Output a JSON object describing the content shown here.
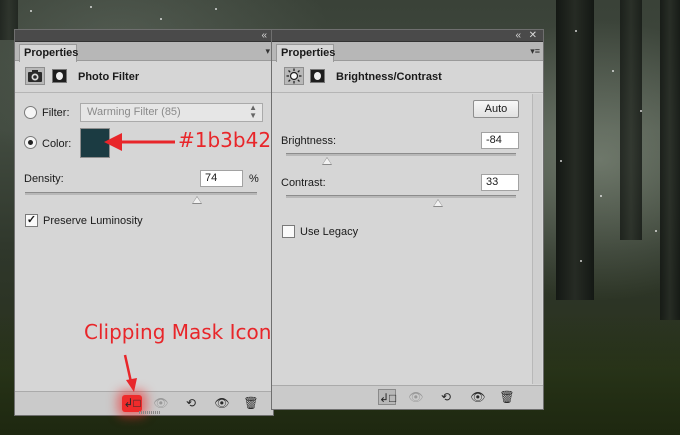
{
  "left_panel": {
    "tab": "Properties",
    "topbar_collapse": "«",
    "menu_glyph": "▾",
    "title": "Photo Filter",
    "filter_label": "Filter:",
    "filter_value": "Warming Filter (85)",
    "filter_selected": false,
    "color_label": "Color:",
    "color_selected": true,
    "color_value": "#1b3b42",
    "density_label": "Density:",
    "density_value": "74",
    "density_unit": "%",
    "density_fraction": 0.74,
    "preserve_label": "Preserve Luminosity",
    "preserve_checked": true,
    "check_mark": "✓"
  },
  "right_panel": {
    "tab": "Properties",
    "topbar_collapse": "«",
    "close_glyph": "✕",
    "menu_glyph": "▾≡",
    "title": "Brightness/Contrast",
    "auto_label": "Auto",
    "brightness_label": "Brightness:",
    "brightness_value": "-84",
    "brightness_fraction": 0.18,
    "contrast_label": "Contrast:",
    "contrast_value": "33",
    "contrast_fraction": 0.66,
    "legacy_label": "Use Legacy",
    "legacy_checked": false
  },
  "footer_icons": {
    "clip": "↲□",
    "view_previous": "👁",
    "reset": "⟲",
    "visibility": "👁",
    "delete": "🗑"
  },
  "annotations": {
    "color_note": "#1b3b42",
    "clip_note": "Clipping Mask Icon",
    "accent_color": "#e8262a"
  }
}
